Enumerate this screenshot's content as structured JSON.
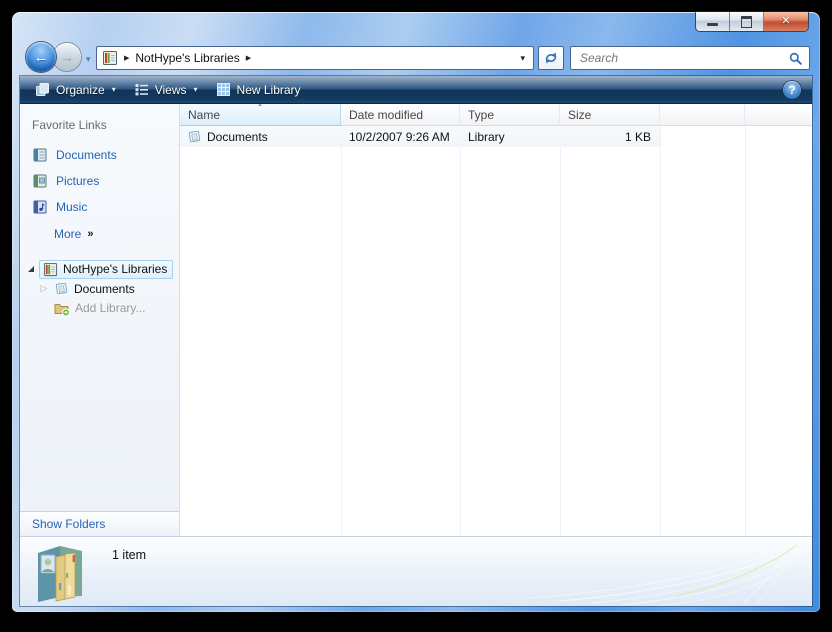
{
  "icons": {
    "close_glyph": "✕",
    "back_glyph": "←",
    "forward_glyph": "→",
    "dropdown_glyph": "▾",
    "breadcrumb_arrow_glyph": "▶",
    "more_chevron_glyph": "»",
    "sort_asc_glyph": "▲",
    "collapsed_glyph": "▷",
    "help_glyph": "?"
  },
  "nav": {
    "breadcrumb": {
      "root_label": "NotHype's Libraries"
    },
    "search": {
      "placeholder": "Search"
    }
  },
  "toolbar": {
    "organize_label": "Organize",
    "views_label": "Views",
    "new_library_label": "New Library"
  },
  "sidebar": {
    "favorites_header": "Favorite Links",
    "favorites": [
      {
        "label": "Documents"
      },
      {
        "label": "Pictures"
      },
      {
        "label": "Music"
      }
    ],
    "more_label": "More",
    "tree": {
      "root_label": "NotHype's Libraries",
      "child_label": "Documents",
      "add_label": "Add Library..."
    },
    "show_folders_label": "Show Folders"
  },
  "list": {
    "columns": [
      {
        "label": "Name"
      },
      {
        "label": "Date modified"
      },
      {
        "label": "Type"
      },
      {
        "label": "Size"
      }
    ],
    "rows": [
      {
        "name": "Documents",
        "date_modified": "10/2/2007 9:26 AM",
        "type": "Library",
        "size": "1 KB"
      }
    ]
  },
  "statusbar": {
    "item_count": "1 item"
  },
  "colors": {
    "accent_blue": "#3f8bdf",
    "link_blue": "#2663b5",
    "toolbar_dark": "#123457",
    "close_red": "#c14f35",
    "selection_blue": "#dcf0fc"
  }
}
